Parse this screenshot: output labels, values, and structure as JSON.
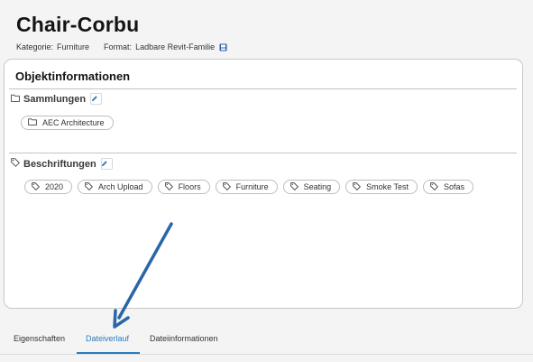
{
  "header": {
    "title": "Chair-Corbu",
    "category_label": "Kategorie:",
    "category_value": "Furniture",
    "format_label": "Format:",
    "format_value": "Ladbare Revit-Familie",
    "format_icon": "revit-file-icon"
  },
  "card": {
    "title": "Objektinformationen",
    "collections": {
      "heading": "Sammlungen",
      "icon": "folder-icon",
      "edit_icon": "pencil-icon",
      "items": [
        "AEC Architecture"
      ]
    },
    "labels": {
      "heading": "Beschriftungen",
      "icon": "tag-icon",
      "edit_icon": "pencil-icon",
      "items": [
        "2020",
        "Arch Upload",
        "Floors",
        "Furniture",
        "Seating",
        "Smoke Test",
        "Sofas"
      ]
    }
  },
  "tabs": {
    "items": [
      "Eigenschaften",
      "Dateiverlauf",
      "Dateiinformationen"
    ],
    "active": "Dateiverlauf"
  },
  "colors": {
    "accent": "#2c7bbf",
    "annotation_arrow": "#2a65a8"
  }
}
